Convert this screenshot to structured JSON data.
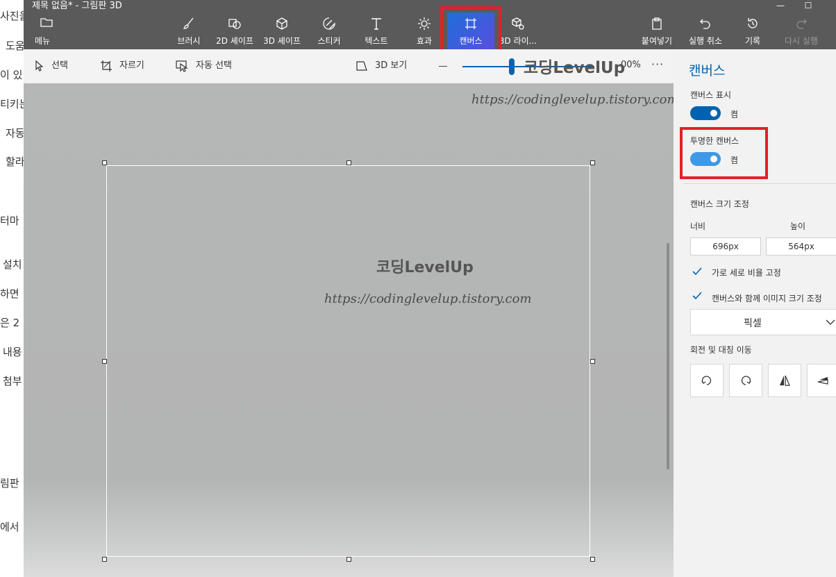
{
  "background_doc": {
    "fragments": [
      "사진을",
      "도움",
      "이 있",
      "티키는",
      "자동",
      "할라",
      "터마",
      "설치",
      "하면",
      "은 2",
      "내용",
      "첨부",
      "림판",
      "에서"
    ]
  },
  "window": {
    "title": "제목 없음* - 그림판 3D",
    "minimize": "—",
    "maximize": "☐"
  },
  "ribbon": {
    "menu": "메뉴",
    "brush": "브러시",
    "shapes2d": "2D 셰이프",
    "shapes3d": "3D 셰이프",
    "stickers": "스티커",
    "text": "텍스트",
    "effects": "효과",
    "canvas": "캔버스",
    "library3d": "3D 라이...",
    "paste": "붙여넣기",
    "undo": "실행 취소",
    "history": "기록",
    "redo": "다시 실행"
  },
  "toolbar": {
    "select": "선택",
    "crop": "자르기",
    "magic_select": "자동 선택",
    "view3d": "3D 보기",
    "zoom_percent": "00%",
    "more": "···",
    "overlay_title": "코딩LevelUp"
  },
  "canvas": {
    "watermark_url_top": "https://codinglevelup.tistory.com",
    "watermark_title": "코딩LevelUp",
    "watermark_url": "https://codinglevelup.tistory.com"
  },
  "panel": {
    "title": "캔버스",
    "show_canvas_label": "캔버스 표시",
    "show_canvas_state": "켬",
    "transparent_label": "투명한 캔버스",
    "transparent_state": "켬",
    "resize_label": "캔버스 크기 조정",
    "width_label": "너비",
    "height_label": "높이",
    "width_value": "696px",
    "height_value": "564px",
    "lock_ratio": "가로 세로 비율 고정",
    "resize_image": "캔버스와 함께 이미지 크기 조정",
    "unit": "픽셀",
    "rotate_flip_label": "회전 및 대칭 이동"
  },
  "colors": {
    "accent": "#0063b1",
    "highlight": "#e2202a",
    "ribbon": "#5a5a5a"
  }
}
